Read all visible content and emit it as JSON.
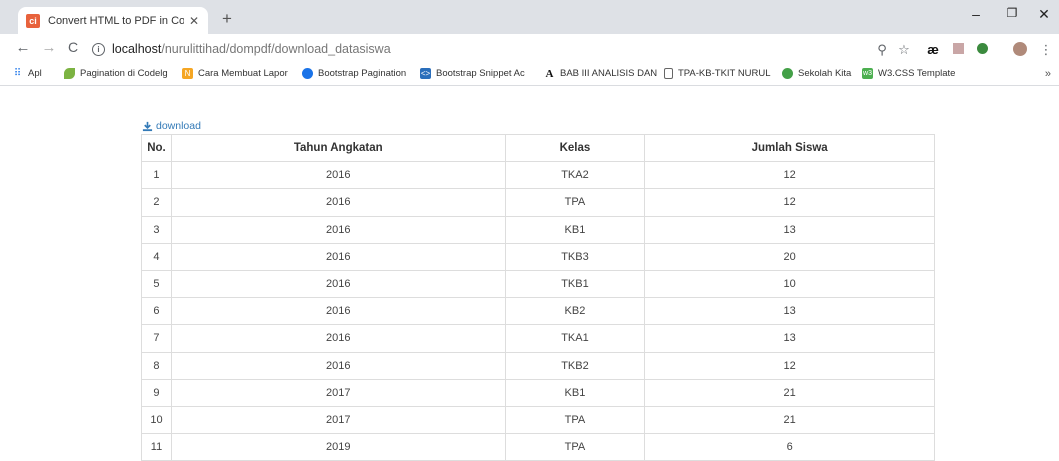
{
  "browser": {
    "tab_title": "Convert HTML to PDF in Codelgr",
    "url_host": "localhost",
    "url_path": "/nurulittihad/dompdf/download_datasiswa",
    "bookmarks": [
      {
        "label": "Apl",
        "icon": "apps-grid-icon"
      },
      {
        "label": "Pagination di Codelg",
        "icon": "leaf-icon"
      },
      {
        "label": "Cara Membuat Lapor",
        "icon": "nb-icon"
      },
      {
        "label": "Bootstrap Pagination",
        "icon": "circle-icon"
      },
      {
        "label": "Bootstrap Snippet Ac",
        "icon": "snippet-icon"
      },
      {
        "label": "BAB III ANALISIS DAN",
        "icon": "letter-a-icon"
      },
      {
        "label": "TPA-KB-TKIT NURUL",
        "icon": "page-icon"
      },
      {
        "label": "Sekolah Kita",
        "icon": "green-logo-icon"
      },
      {
        "label": "W3.CSS Template",
        "icon": "w3-icon"
      }
    ]
  },
  "page": {
    "download_label": "download",
    "table": {
      "headers": [
        "No.",
        "Tahun Angkatan",
        "Kelas",
        "Jumlah Siswa"
      ],
      "rows": [
        [
          "1",
          "2016",
          "TKA2",
          "12"
        ],
        [
          "2",
          "2016",
          "TPA",
          "12"
        ],
        [
          "3",
          "2016",
          "KB1",
          "13"
        ],
        [
          "4",
          "2016",
          "TKB3",
          "20"
        ],
        [
          "5",
          "2016",
          "TKB1",
          "10"
        ],
        [
          "6",
          "2016",
          "KB2",
          "13"
        ],
        [
          "7",
          "2016",
          "TKA1",
          "13"
        ],
        [
          "8",
          "2016",
          "TKB2",
          "12"
        ],
        [
          "9",
          "2017",
          "KB1",
          "21"
        ],
        [
          "10",
          "2017",
          "TPA",
          "21"
        ],
        [
          "11",
          "2019",
          "TPA",
          "6"
        ]
      ]
    }
  }
}
